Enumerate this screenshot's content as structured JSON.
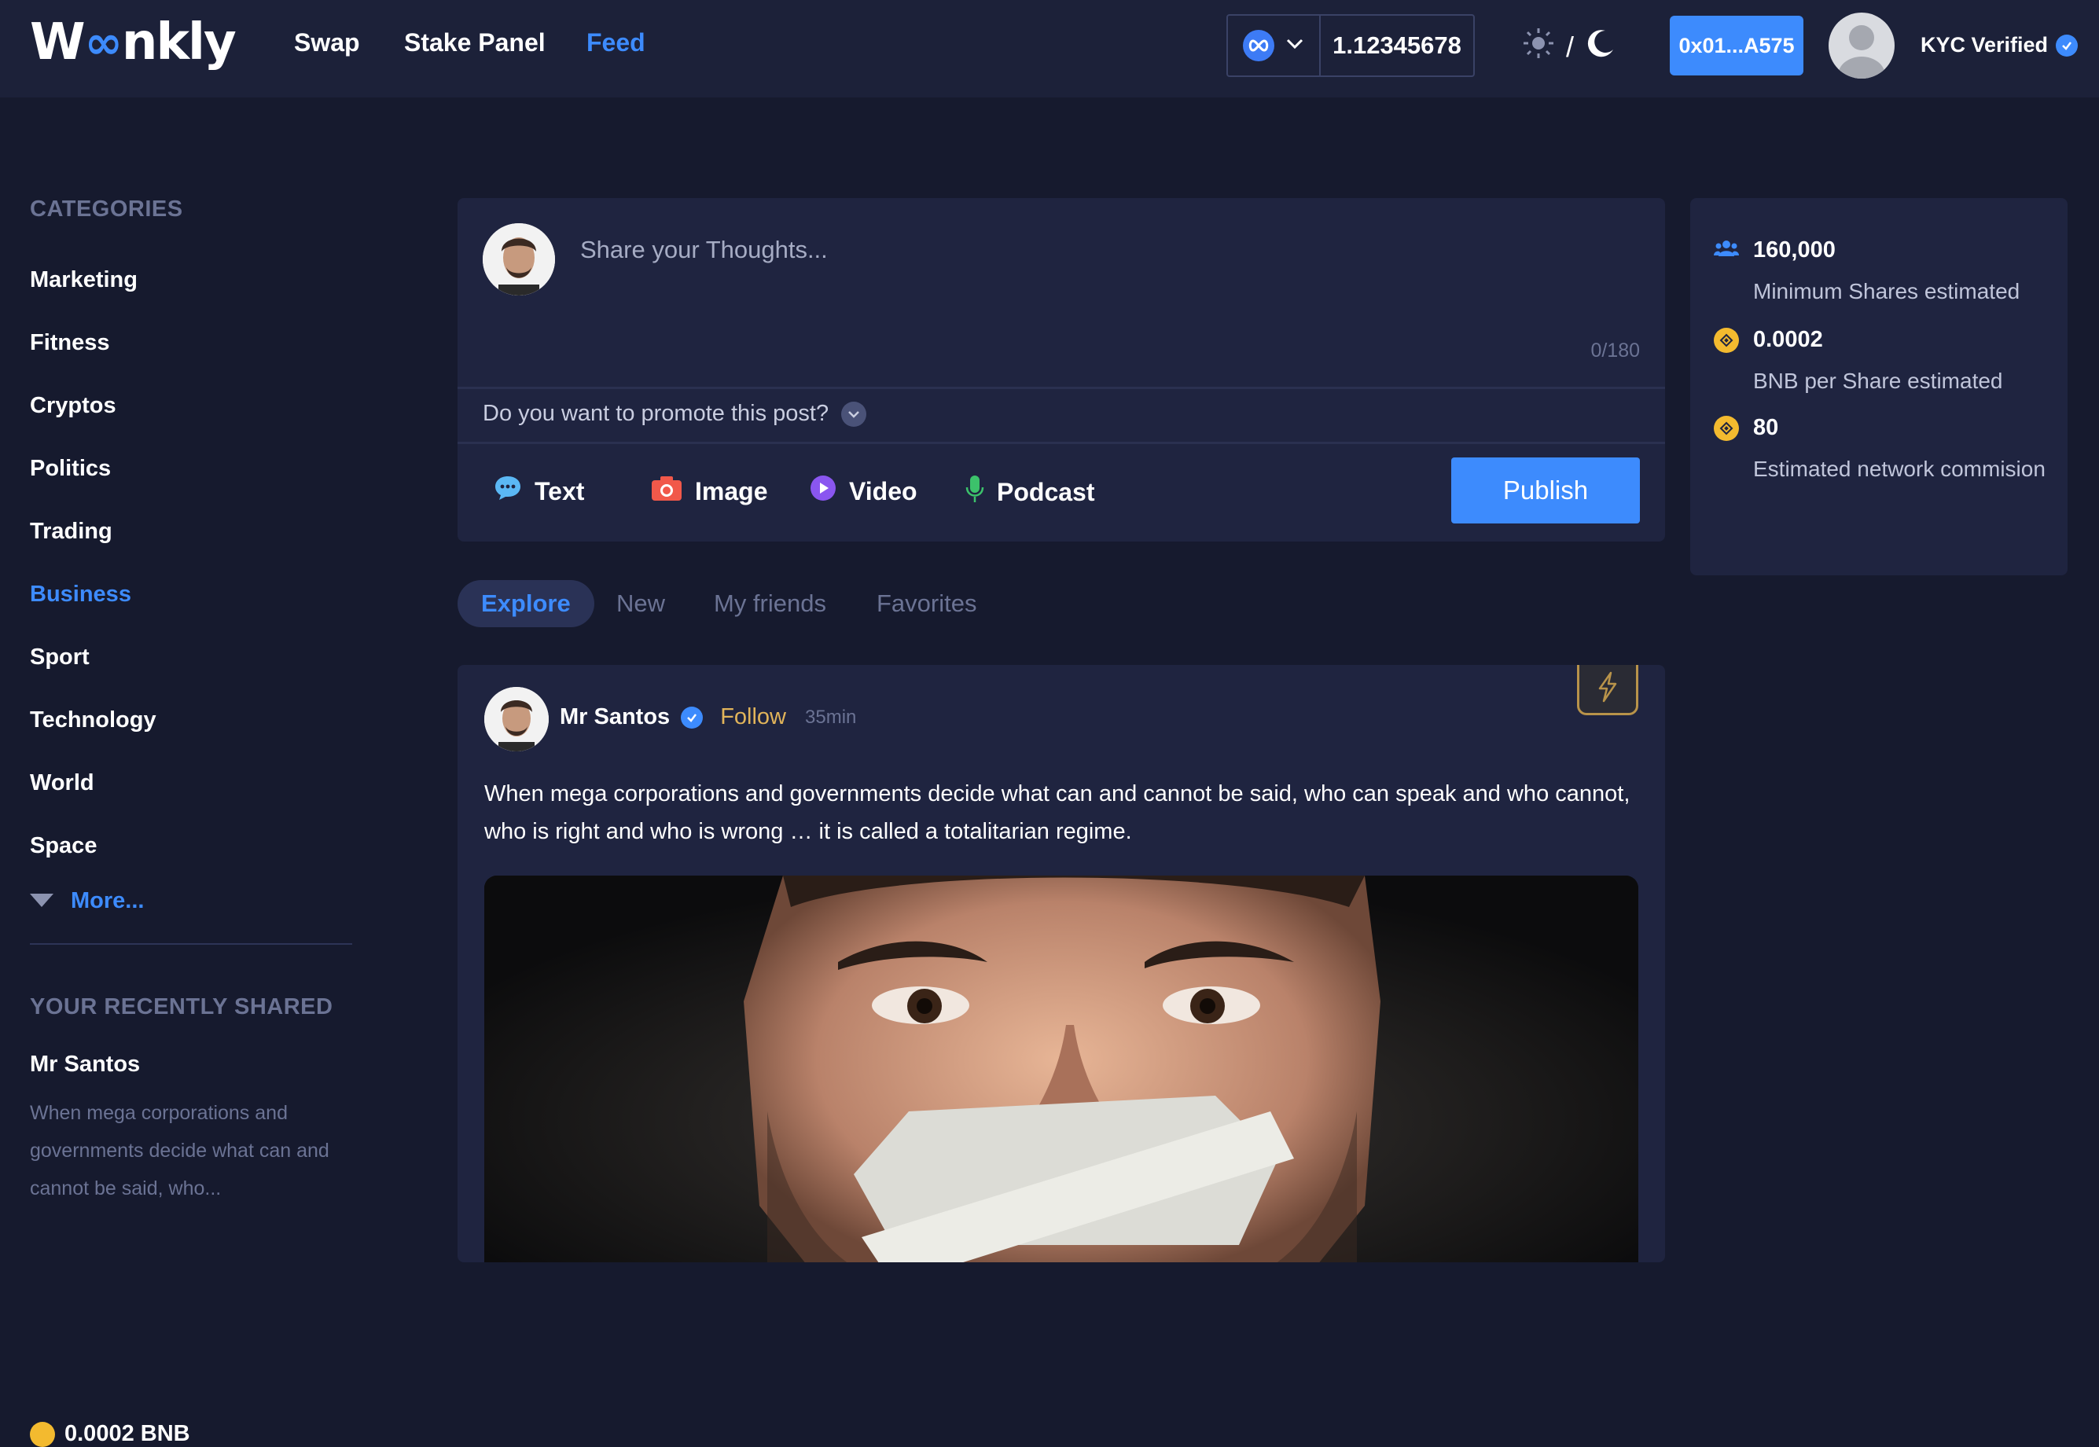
{
  "header": {
    "logo_text": "Woonkly",
    "nav": [
      {
        "label": "Swap"
      },
      {
        "label": "Stake Panel"
      },
      {
        "label": "Feed"
      }
    ],
    "wallet_balance": "1.12345678",
    "theme_separator": "/",
    "address": "0x01...A575",
    "kyc_label": "KYC Verified"
  },
  "sidebar": {
    "categories_title": "CATEGORIES",
    "categories": [
      {
        "label": "Marketing"
      },
      {
        "label": "Fitness"
      },
      {
        "label": "Cryptos"
      },
      {
        "label": "Politics"
      },
      {
        "label": "Trading"
      },
      {
        "label": "Business"
      },
      {
        "label": "Sport"
      },
      {
        "label": "Technology"
      },
      {
        "label": "World"
      },
      {
        "label": "Space"
      }
    ],
    "more_label": "More...",
    "recent_title": "YOUR RECENTLY SHARED",
    "recent_name": "Mr Santos",
    "recent_text": "When mega corporations and governments decide what can and cannot be said, who...",
    "recent_price": "0.0002 BNB"
  },
  "composer": {
    "placeholder": "Share your Thoughts...",
    "counter": "0/180",
    "promote_label": "Do you want to promote this post?",
    "types": [
      {
        "label": "Text"
      },
      {
        "label": "Image"
      },
      {
        "label": "Video"
      },
      {
        "label": "Podcast"
      }
    ],
    "publish_label": "Publish"
  },
  "stats": [
    {
      "value": "160,000",
      "label": "Minimum Shares estimated"
    },
    {
      "value": "0.0002",
      "label": "BNB per Share estimated"
    },
    {
      "value": "80",
      "label": "Estimated network commision"
    }
  ],
  "tabs": [
    {
      "label": "Explore"
    },
    {
      "label": "New"
    },
    {
      "label": "My friends"
    },
    {
      "label": "Favorites"
    }
  ],
  "post": {
    "author": "Mr Santos",
    "follow_label": "Follow",
    "time": "35min",
    "text": "When mega corporations and governments decide what can and cannot be said, who can speak and who cannot, who is right and who is wrong … it is called a totalitarian regime."
  },
  "colors": {
    "accent": "#3d8bfd",
    "background": "#161a2e",
    "panel": "#1f2440",
    "gold": "#f3ba2f"
  }
}
